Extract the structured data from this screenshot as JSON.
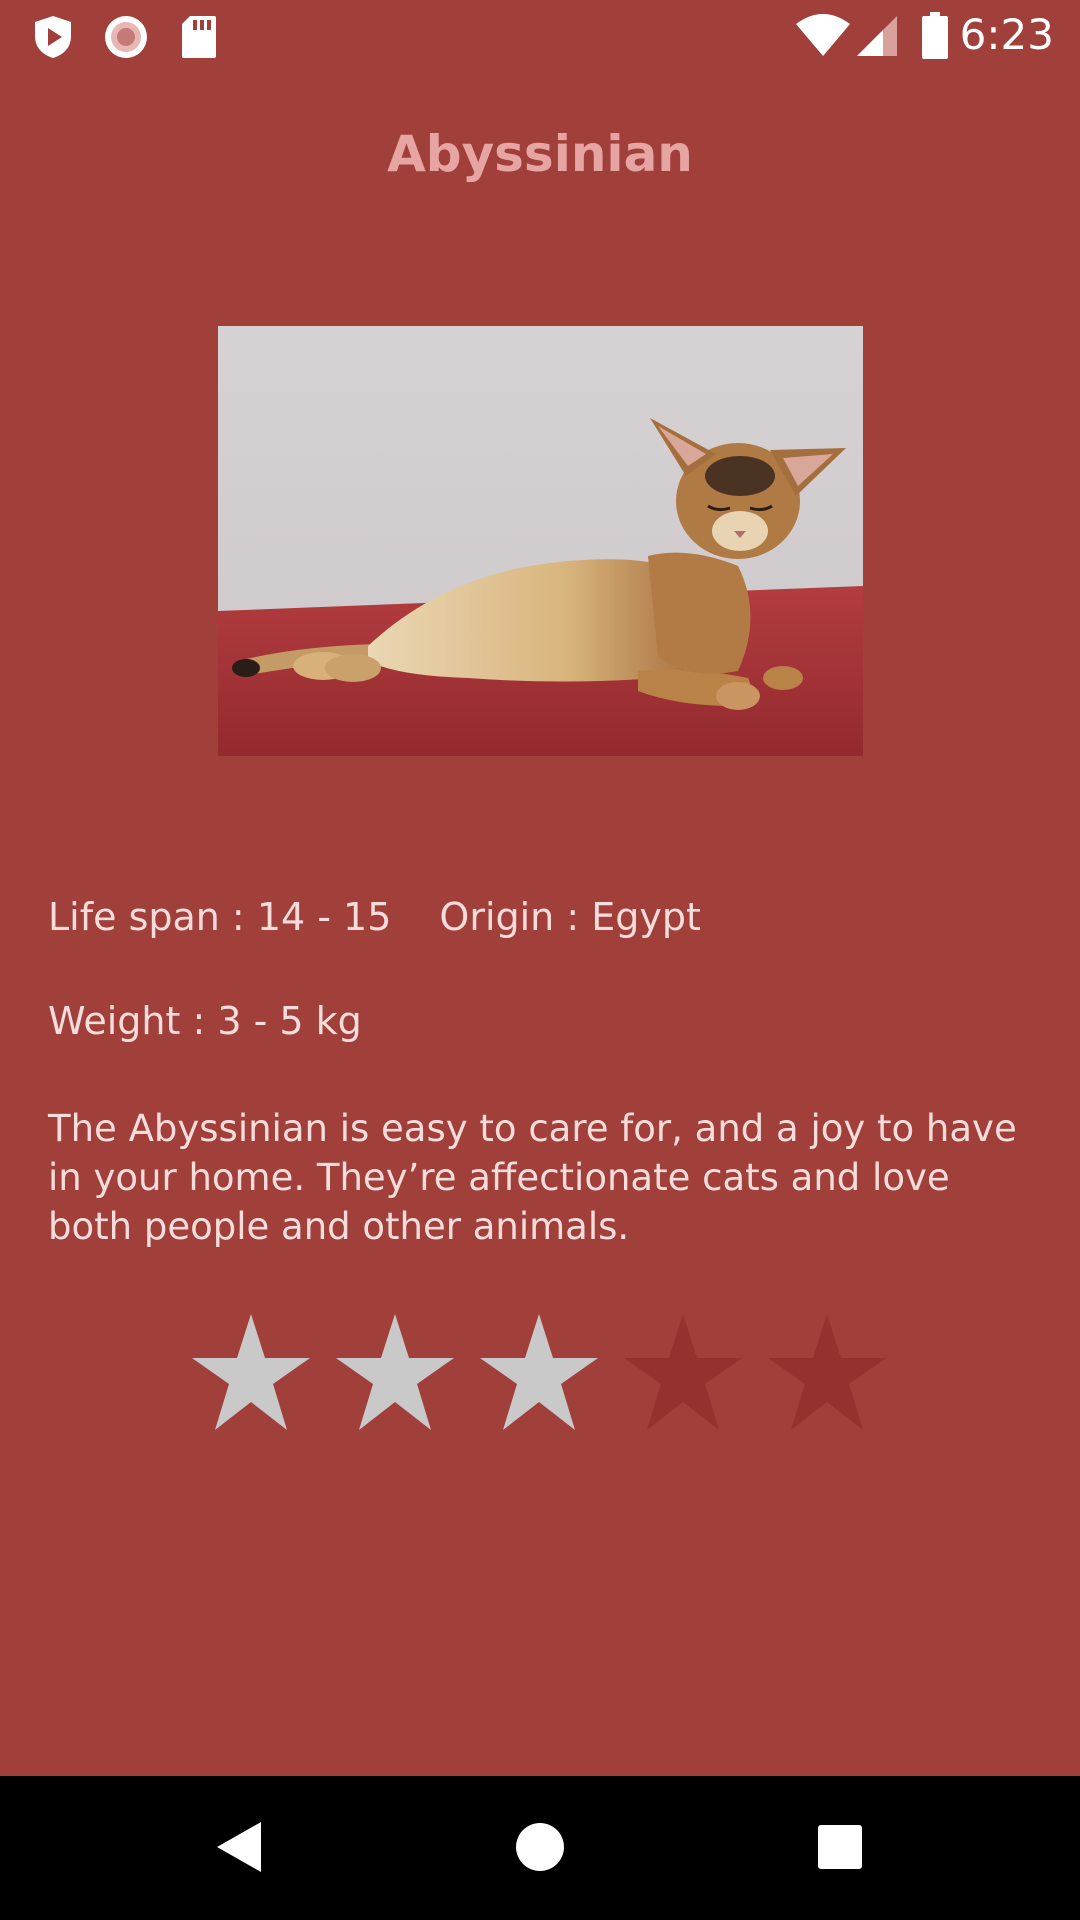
{
  "status_bar": {
    "time": "6:23",
    "left_icons": [
      "shield-play-icon",
      "record-icon",
      "sd-card-icon"
    ],
    "right_icons": [
      "wifi-icon",
      "signal-icon",
      "battery-icon"
    ]
  },
  "title": "Abyssinian",
  "photo": {
    "subject": "abyssinian-cat-photo"
  },
  "facts": {
    "life_span": "Life span : 14 - 15",
    "origin": "Origin : Egypt",
    "weight": "Weight : 3 - 5 kg"
  },
  "description": "The Abyssinian is easy to care for, and a joy to have in your home. They’re affectionate cats and love both people and other animals.",
  "rating": {
    "value": 3,
    "max": 5,
    "filled_color": "#c9c9c9",
    "empty_color": "#93322e"
  },
  "nav_bar": {
    "buttons": [
      "back-icon",
      "home-icon",
      "recents-icon"
    ]
  },
  "colors": {
    "background": "#a13f3a",
    "title": "#e6a5a2",
    "text": "#f6dcda",
    "nav_bar": "#000000"
  }
}
